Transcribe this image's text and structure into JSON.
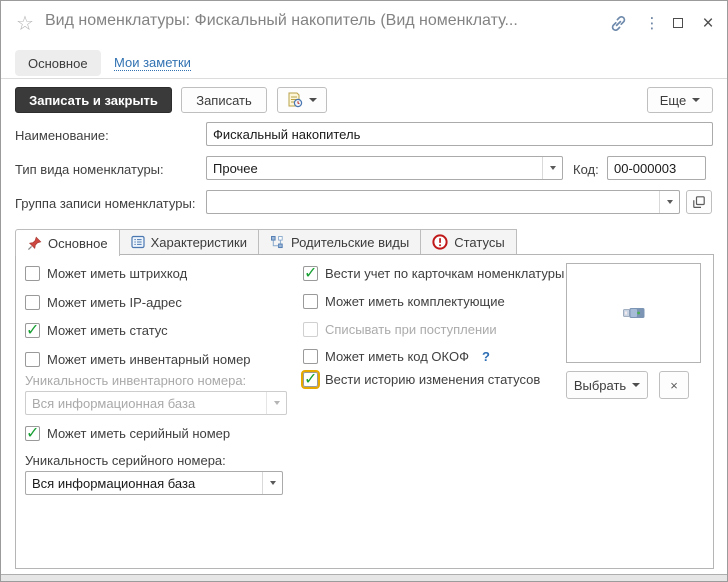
{
  "window": {
    "title": "Вид номенклатуры: Фискальный накопитель (Вид номенклату...",
    "icons": [
      "star-icon",
      "link-icon",
      "kebab-menu-icon",
      "maximize-icon",
      "close-icon"
    ]
  },
  "nav": {
    "primary": "Основное",
    "notes": "Мои заметки"
  },
  "toolbar": {
    "save_and_close": "Записать и закрыть",
    "save": "Записать",
    "history_icon": "document-clock-icon",
    "more": "Еще"
  },
  "form": {
    "name_label": "Наименование:",
    "name_value": "Фискальный накопитель",
    "type_label": "Тип вида номенклатуры:",
    "type_value": "Прочее",
    "code_label": "Код:",
    "code_value": "00-000003",
    "group_label": "Группа записи номенклатуры:",
    "group_value": ""
  },
  "tabs": [
    {
      "label": "Основное",
      "icon": "pushpin-icon",
      "active": true
    },
    {
      "label": "Характеристики",
      "icon": "form-list-icon",
      "active": false
    },
    {
      "label": "Родительские виды",
      "icon": "hierarchy-icon",
      "active": false
    },
    {
      "label": "Статусы",
      "icon": "alert-circle-icon",
      "active": false
    }
  ],
  "main": {
    "left_checks": [
      {
        "label": "Может иметь штрихкод",
        "checked": false
      },
      {
        "label": "Может иметь IP-адрес",
        "checked": false
      },
      {
        "label": "Может иметь статус",
        "checked": true
      },
      {
        "label": "Может иметь инвентарный номер",
        "checked": false
      }
    ],
    "inv_unique": {
      "label": "Уникальность инвентарного номера:",
      "value": "Вся информационная база",
      "disabled": true
    },
    "serial_check": {
      "label": "Может иметь серийный номер",
      "checked": true
    },
    "serial_unique": {
      "label": "Уникальность серийного номера:",
      "value": "Вся информационная база",
      "disabled": false
    },
    "right_checks": [
      {
        "label": "Вести учет по карточкам номенклатуры",
        "checked": true
      },
      {
        "label": "Может иметь комплектующие",
        "checked": false
      },
      {
        "label": "Списывать при поступлении",
        "checked": false,
        "disabled": true
      },
      {
        "label": "Может иметь код ОКОФ",
        "checked": false
      },
      {
        "label": "Вести историю изменения статусов",
        "checked": true,
        "focused": true
      }
    ],
    "okof_help": "?",
    "image_panel": {
      "image": "usb-flash-drive-image",
      "select_button": "Выбрать",
      "clear_button": "×"
    }
  },
  "colors": {
    "accent_dark_button": "#3a3a3a",
    "link_blue": "#3272b2",
    "check_green": "#18a033",
    "focus_yellow": "#e7a800",
    "status_red": "#c01818",
    "title_gray": "#838383"
  }
}
